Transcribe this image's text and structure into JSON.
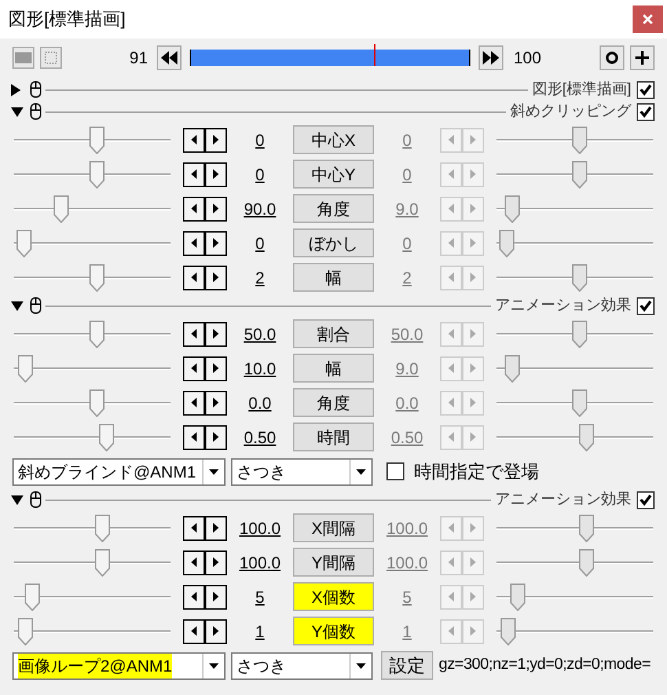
{
  "window": {
    "title": "図形[標準描画]"
  },
  "timeline": {
    "start": "91",
    "end": "100",
    "level": 0.66
  },
  "sections": [
    {
      "label": "図形[標準描画]",
      "expanded": false,
      "checked": true
    },
    {
      "label": "斜めクリッピング",
      "expanded": true,
      "checked": true,
      "rows": [
        {
          "name": "中心X",
          "highlight": false,
          "start": {
            "value": "0",
            "level": 0.53
          },
          "end": {
            "value": "0",
            "level": 0.53
          }
        },
        {
          "name": "中心Y",
          "highlight": false,
          "start": {
            "value": "0",
            "level": 0.53
          },
          "end": {
            "value": "0",
            "level": 0.53
          }
        },
        {
          "name": "角度",
          "highlight": false,
          "start": {
            "value": "90.0",
            "level": 0.28
          },
          "end": {
            "value": "9.0",
            "level": 0.06
          }
        },
        {
          "name": "ぼかし",
          "highlight": false,
          "start": {
            "value": "0",
            "level": 0.02
          },
          "end": {
            "value": "0",
            "level": 0.02
          }
        },
        {
          "name": "幅",
          "highlight": false,
          "start": {
            "value": "2",
            "level": 0.53
          },
          "end": {
            "value": "2",
            "level": 0.53
          }
        }
      ]
    },
    {
      "label": "アニメーション効果",
      "expanded": true,
      "checked": true,
      "rows": [
        {
          "name": "割合",
          "highlight": false,
          "start": {
            "value": "50.0",
            "level": 0.53
          },
          "end": {
            "value": "50.0",
            "level": 0.53
          }
        },
        {
          "name": "幅",
          "highlight": false,
          "start": {
            "value": "10.0",
            "level": 0.03
          },
          "end": {
            "value": "9.0",
            "level": 0.06
          }
        },
        {
          "name": "角度",
          "highlight": false,
          "start": {
            "value": "0.0",
            "level": 0.53
          },
          "end": {
            "value": "0.0",
            "level": 0.53
          }
        },
        {
          "name": "時間",
          "highlight": false,
          "start": {
            "value": "0.50",
            "level": 0.6
          },
          "end": {
            "value": "0.50",
            "level": 0.58
          }
        }
      ],
      "footer": {
        "effect": "斜めブラインド@ANM1",
        "effect_highlight": false,
        "author": "さつき",
        "kind": "checkbox",
        "option": "時間指定で登場",
        "checked": false
      }
    },
    {
      "label": "アニメーション効果",
      "expanded": true,
      "checked": true,
      "rows": [
        {
          "name": "X間隔",
          "highlight": false,
          "start": {
            "value": "100.0",
            "level": 0.57
          },
          "end": {
            "value": "100.0",
            "level": 0.58
          }
        },
        {
          "name": "Y間隔",
          "highlight": false,
          "start": {
            "value": "100.0",
            "level": 0.57
          },
          "end": {
            "value": "100.0",
            "level": 0.58
          }
        },
        {
          "name": "X個数",
          "highlight": true,
          "start": {
            "value": "5",
            "level": 0.08
          },
          "end": {
            "value": "5",
            "level": 0.1
          }
        },
        {
          "name": "Y個数",
          "highlight": true,
          "start": {
            "value": "1",
            "level": 0.03
          },
          "end": {
            "value": "1",
            "level": 0.03
          }
        }
      ],
      "footer": {
        "effect": "画像ループ2@ANM1",
        "effect_highlight": true,
        "author": "さつき",
        "kind": "settings",
        "button": "設定",
        "params": "gz=300;nz=1;yd=0;zd=0;mode="
      }
    }
  ]
}
